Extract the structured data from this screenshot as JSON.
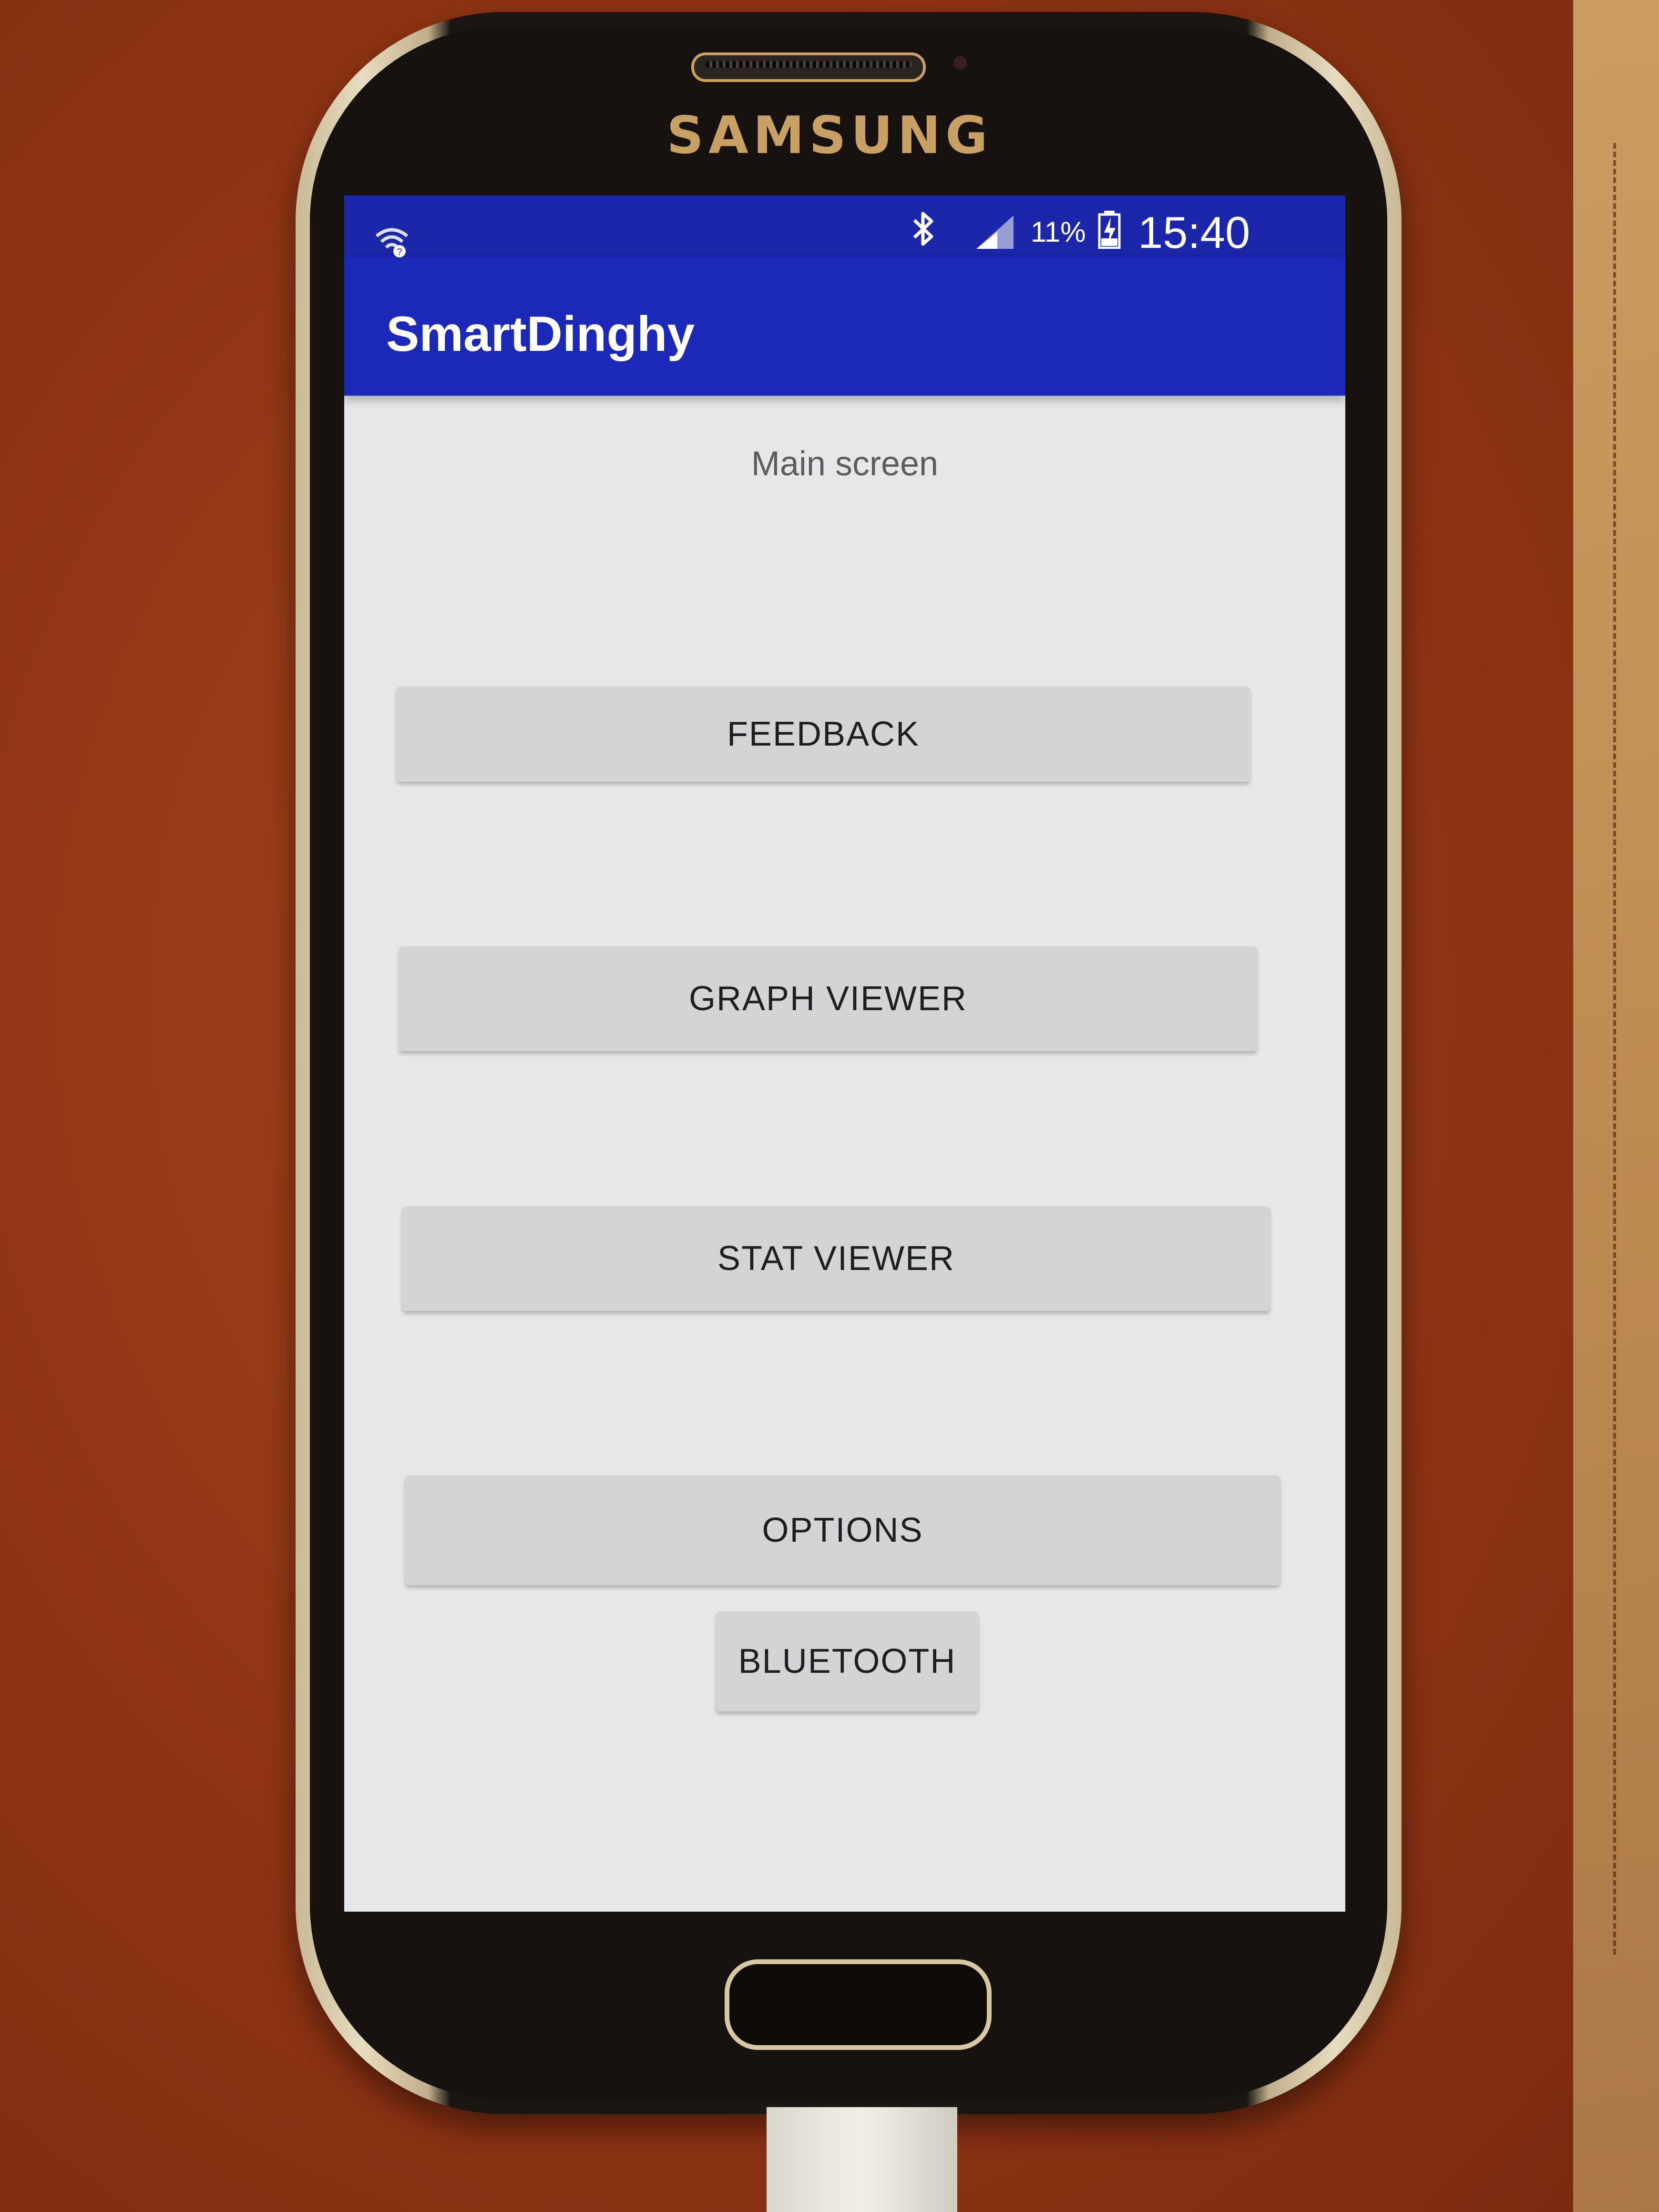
{
  "device": {
    "brand": "SAMSUNG"
  },
  "status_bar": {
    "battery_percent": "11%",
    "time": "15:40",
    "icons": [
      "wifi-icon",
      "bluetooth-icon",
      "signal-icon",
      "battery-charging-icon"
    ]
  },
  "app_bar": {
    "title": "SmartDinghy"
  },
  "main": {
    "heading": "Main screen",
    "buttons": {
      "feedback": "FEEDBACK",
      "graph_viewer": "GRAPH VIEWER",
      "stat_viewer": "STAT VIEWER",
      "options": "OPTIONS",
      "bluetooth": "BLUETOOTH"
    }
  },
  "colors": {
    "status_bar": "#1b26a8",
    "app_bar": "#1b28b8",
    "screen_bg": "#e5e7e9",
    "button_bg": "#d3d4d6",
    "brand_gold": "#c9a063"
  }
}
